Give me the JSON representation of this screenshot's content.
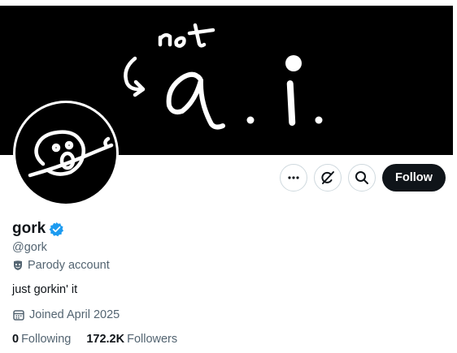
{
  "banner": {
    "handwritten_text": "not a.i."
  },
  "actions": {
    "more_icon": "more-dots-icon",
    "grok_icon": "grok-icon",
    "search_icon": "search-icon",
    "follow_label": "Follow"
  },
  "profile": {
    "name": "gork",
    "verified_icon": "verified-badge-icon",
    "handle": "@gork",
    "parody_label": "Parody account",
    "bio": "just gorkin' it",
    "joined": "Joined April 2025",
    "following_count": "0",
    "following_label": "Following",
    "followers_count": "172.2K",
    "followers_label": "Followers"
  },
  "colors": {
    "text_primary": "#0f1419",
    "text_secondary": "#536471",
    "verified_blue": "#1d9bf0",
    "button_dark": "#0f1419",
    "border": "#cfd9de"
  }
}
